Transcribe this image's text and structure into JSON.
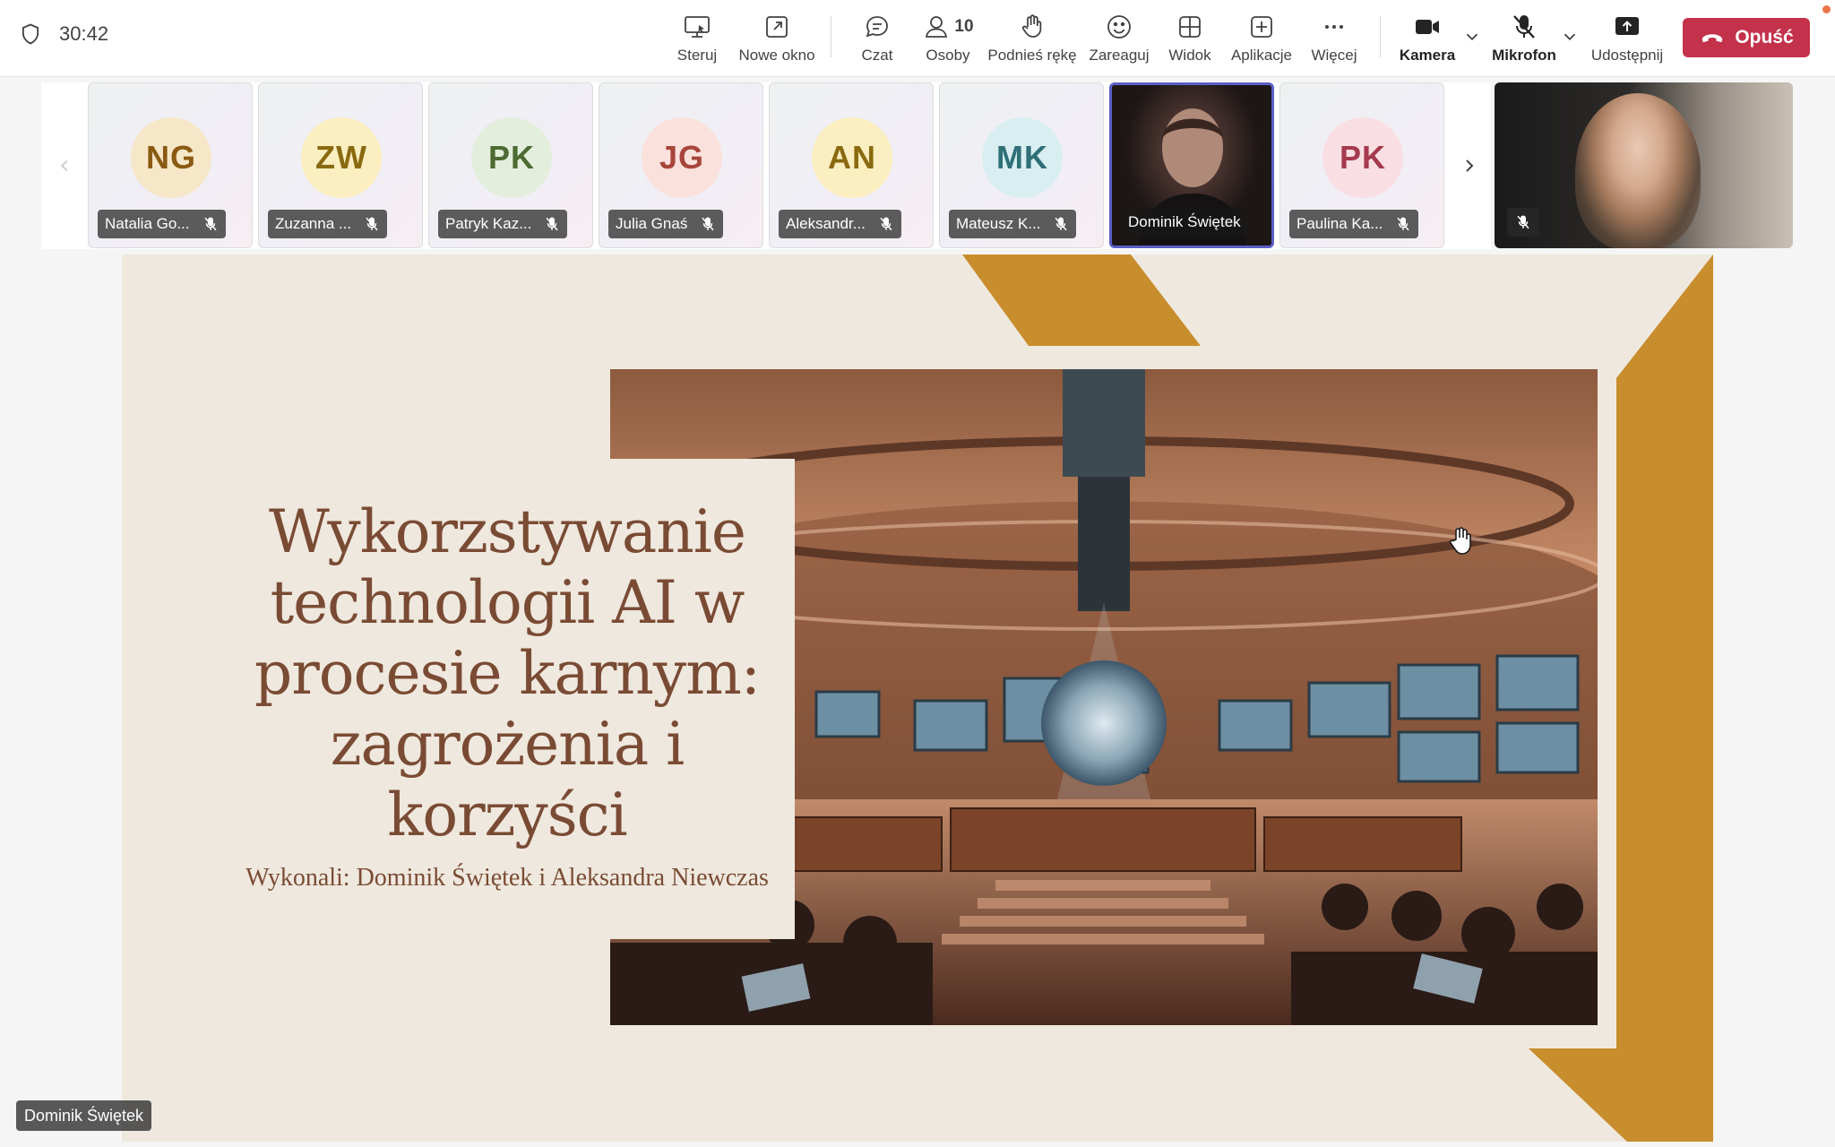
{
  "toolbar": {
    "timer": "30:42",
    "buttons": {
      "control": "Steruj",
      "new_window": "Nowe okno",
      "chat": "Czat",
      "people": "Osoby",
      "people_count": "10",
      "raise_hand": "Podnieś rękę",
      "react": "Zareaguj",
      "view": "Widok",
      "apps": "Aplikacje",
      "more": "Więcej",
      "camera": "Kamera",
      "mic": "Mikrofon",
      "share": "Udostępnij"
    },
    "leave_label": "Opuść"
  },
  "participants": [
    {
      "initials": "NG",
      "name": "Natalia Go...",
      "bg": "#f6e7c8",
      "fg": "#8a5a12"
    },
    {
      "initials": "ZW",
      "name": "Zuzanna ...",
      "bg": "#fbeec0",
      "fg": "#8a6a10"
    },
    {
      "initials": "PK",
      "name": "Patryk Kaz...",
      "bg": "#e4eedd",
      "fg": "#4d6b33"
    },
    {
      "initials": "JG",
      "name": "Julia Gnaś",
      "bg": "#fbe1dc",
      "fg": "#a8453a"
    },
    {
      "initials": "AN",
      "name": "Aleksandr...",
      "bg": "#fbeec0",
      "fg": "#8a6a10"
    },
    {
      "initials": "MK",
      "name": "Mateusz K...",
      "bg": "#d9eef0",
      "fg": "#2f6f78"
    },
    {
      "initials": "",
      "name": "Dominik Świętek",
      "bg": "",
      "fg": ""
    },
    {
      "initials": "PK",
      "name": "Paulina Ka...",
      "bg": "#f9dfe3",
      "fg": "#a53a4e"
    }
  ],
  "slide": {
    "title_lines": [
      "Wykorzstywanie",
      "technologii AI w",
      "procesie karnym:",
      "zagrożenia i",
      "korzyści"
    ],
    "subtitle": "Wykonali: Dominik Świętek i Aleksandra Niewczas",
    "accent": "#c88d2c",
    "text_color": "#7a4b34"
  },
  "presenter_label": "Dominik Świętek",
  "colors": {
    "leave": "#c4314b",
    "active_border": "#5b5fc7"
  }
}
